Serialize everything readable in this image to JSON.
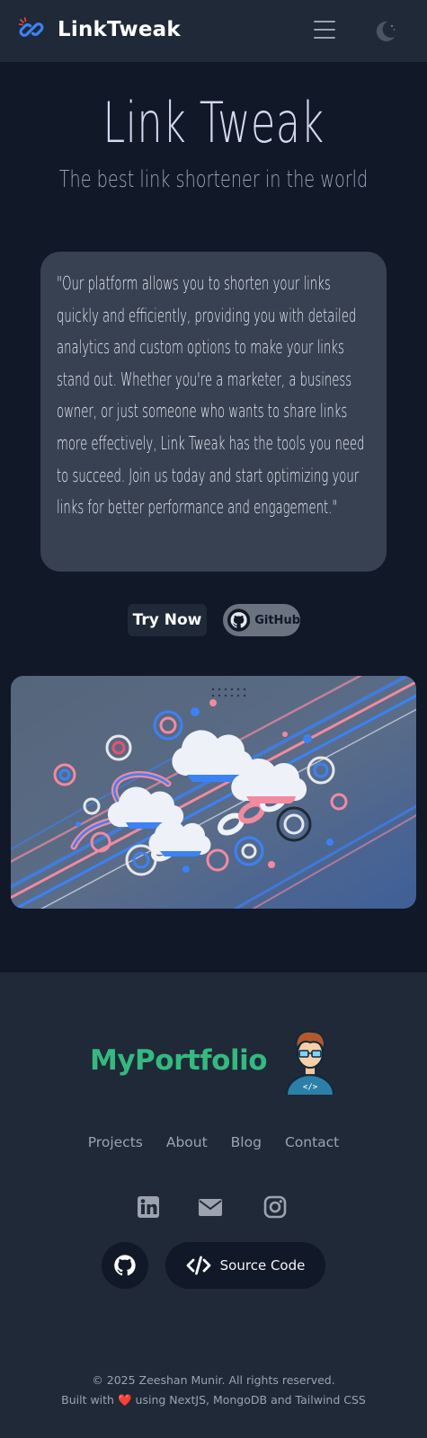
{
  "header": {
    "brand": "LinkTweak",
    "icons": {
      "brand": "link-icon",
      "menu": "hamburger-menu-icon",
      "theme": "moon-icon"
    }
  },
  "hero": {
    "title": "Link Tweak",
    "subtitle": "The best link shortener in the world",
    "quote": "\"Our platform allows you to shorten your links quickly and efficiently, providing you with detailed analytics and custom options to make your links stand out. Whether you're a marketer, a business owner, or just someone who wants to share links more effectively, Link Tweak has the tools you need to succeed. Join us today and start optimizing your links for better performance and engagement.\"",
    "try_label": "Try Now",
    "github_label": "GitHub"
  },
  "footer": {
    "portfolio": "MyPortfolio",
    "nav": [
      "Projects",
      "About",
      "Blog",
      "Contact"
    ],
    "social_icons": [
      "linkedin-icon",
      "mail-icon",
      "instagram-icon"
    ],
    "source_label": "Source Code",
    "copyright": "© 2025 Zeeshan Munir. All rights reserved.",
    "built_prefix": "Built with",
    "heart": "❤️",
    "built_suffix": "using NextJS, MongoDB and Tailwind CSS"
  },
  "colors": {
    "page_bg": "#111827",
    "header_bg": "#1f2937",
    "card_bg": "#374151",
    "accent_green": "#34b97f",
    "accent_blue": "#3b82f6"
  }
}
